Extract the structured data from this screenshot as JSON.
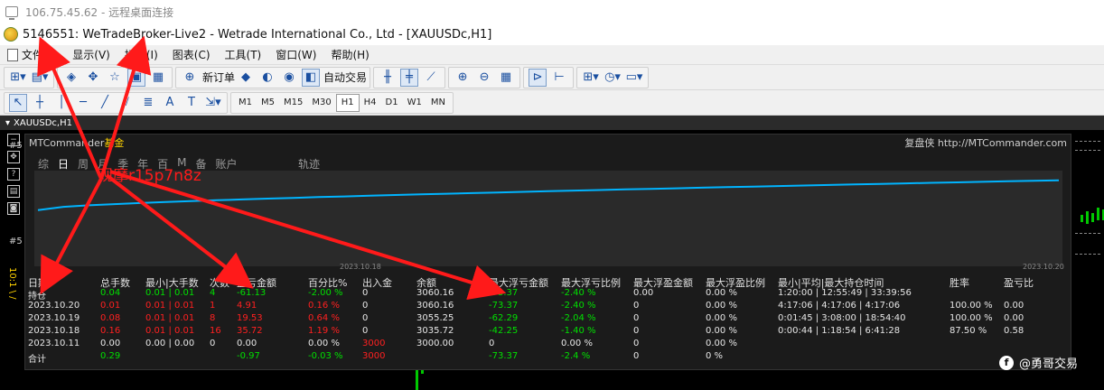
{
  "rdp": {
    "title": "106.75.45.62 - 远程桌面连接"
  },
  "window": {
    "title": "5146551: WeTradeBroker-Live2 - Wetrade International Co., Ltd - [XAUUSDc,H1]"
  },
  "menu": [
    {
      "label": "文件(F)"
    },
    {
      "label": "显示(V)"
    },
    {
      "label": "插入(I)"
    },
    {
      "label": "图表(C)"
    },
    {
      "label": "工具(T)"
    },
    {
      "label": "窗口(W)"
    },
    {
      "label": "帮助(H)"
    }
  ],
  "toolbar": {
    "new_order": "新订单",
    "auto_trade": "自动交易"
  },
  "timeframes": [
    "M1",
    "M5",
    "M15",
    "M30",
    "H1",
    "H4",
    "D1",
    "W1",
    "MN"
  ],
  "chart_tab": {
    "label": "XAUUSDc,H1"
  },
  "side_labels": {
    "top": "#5",
    "mid": "#5",
    "axis": "10:1 \\ /"
  },
  "panel": {
    "brand": "MTCommander",
    "brand_accent": "基金",
    "site": "复盘侠 http://MTCommander.com",
    "tabs": [
      "综",
      "日",
      "周",
      "月",
      "季",
      "年",
      "百",
      "M",
      "备",
      "账户"
    ],
    "track_tab": "轨迹",
    "date_start": "2023.10.18",
    "date_end": "2023.10.20"
  },
  "chart_data": {
    "type": "line",
    "x": [
      "2023.10.18",
      "2023.10.20"
    ],
    "series": [
      {
        "values": [
          3035.72,
          3060.16
        ]
      }
    ]
  },
  "stats": {
    "headers": [
      "日期",
      "总手数",
      "最小|大手数",
      "次数",
      "盈亏金额",
      "百分比%",
      "出入金",
      "余额",
      "最大浮亏金额",
      "最大浮亏比例",
      "最大浮盈金额",
      "最大浮盈比例",
      "最小|平均|最大持仓时间",
      "胜率",
      "盈亏比"
    ],
    "rows": [
      [
        "持仓",
        "0.04",
        "0.01 | 0.01",
        "4",
        "-61.13",
        "-2.00 %",
        "0",
        "3060.16",
        "-73.37",
        "-2.40 %",
        "0.00",
        "0.00 %",
        "1:20:00 | 12:55:49 | 33:39:56",
        "",
        ""
      ],
      [
        "2023.10.20",
        "0.01",
        "0.01 | 0.01",
        "1",
        "4.91",
        "0.16 %",
        "0",
        "3060.16",
        "-73.37",
        "-2.40 %",
        "0",
        "0.00 %",
        "4:17:06 | 4:17:06 | 4:17:06",
        "100.00 %",
        "0.00"
      ],
      [
        "2023.10.19",
        "0.08",
        "0.01 | 0.01",
        "8",
        "19.53",
        "0.64 %",
        "0",
        "3055.25",
        "-62.29",
        "-2.04 %",
        "0",
        "0.00 %",
        "0:01:45 | 3:08:00 | 18:54:40",
        "100.00 %",
        "0.00"
      ],
      [
        "2023.10.18",
        "0.16",
        "0.01 | 0.01",
        "16",
        "35.72",
        "1.19 %",
        "0",
        "3035.72",
        "-42.25",
        "-1.40 %",
        "0",
        "0.00 %",
        "0:00:44 | 1:18:54 | 6:41:28",
        "87.50 %",
        "0.58"
      ],
      [
        "2023.10.11",
        "0.00",
        "0.00 | 0.00",
        "0",
        "0.00",
        "0.00 %",
        "3000",
        "3000.00",
        "0",
        "0.00 %",
        "0",
        "0.00 %",
        "",
        "",
        ""
      ],
      [
        "合计",
        "0.29",
        "",
        "",
        "-0.97",
        "-0.03 %",
        "3000",
        "",
        "-73.37",
        "-2.4 %",
        "0",
        "0 %",
        "",
        "",
        ""
      ]
    ]
  },
  "watermark": {
    "text": "观摩r15p7n8z",
    "brand": "@勇哥交易"
  },
  "colors": {
    "accent": "#00b4ff",
    "profit": "#00e000",
    "loss": "#ff2020",
    "annotation": "#ff1a1a"
  }
}
